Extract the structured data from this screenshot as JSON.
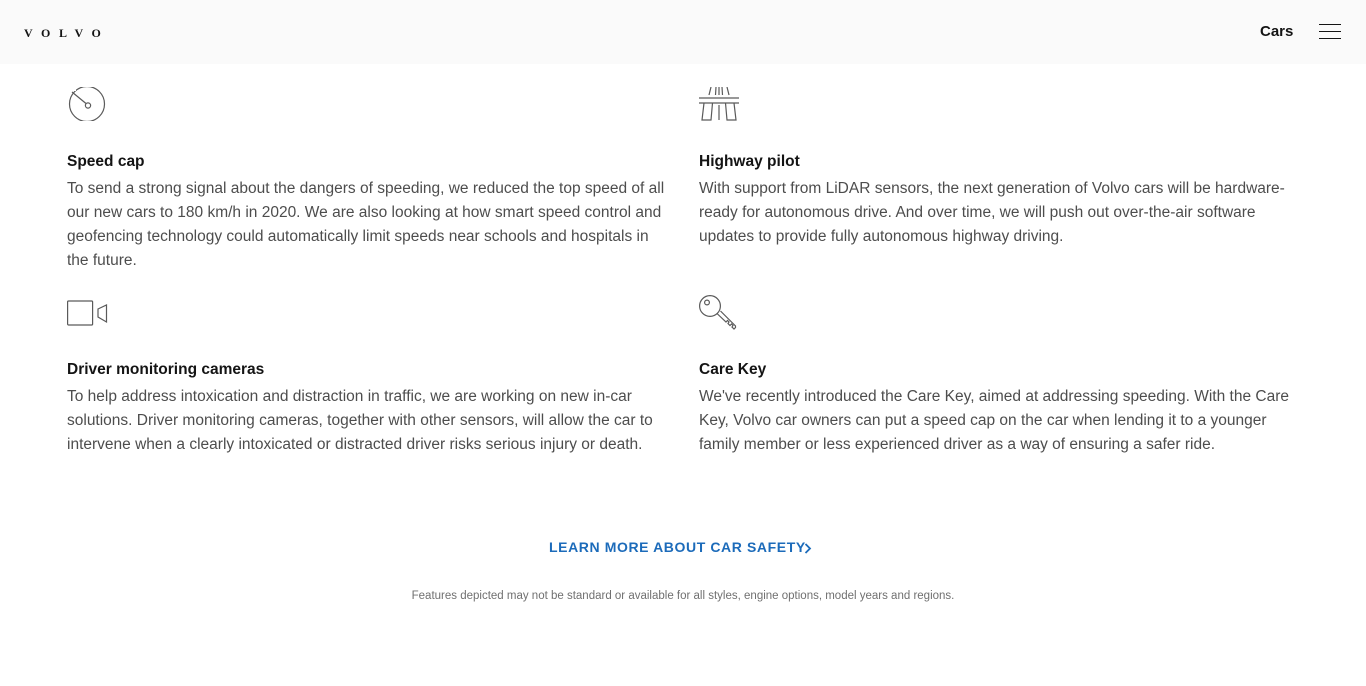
{
  "header": {
    "logo": "VOLVO",
    "nav_cars": "Cars",
    "menu_icon": "hamburger-menu-icon"
  },
  "features": [
    {
      "icon": "speedometer-icon",
      "title": "Speed cap",
      "text": "To send a strong signal about the dangers of speeding, we reduced the top speed of all our new cars to 180 km/h in 2020. We are also looking at how smart speed control and geofencing technology could automatically limit speeds near schools and hospitals in the future."
    },
    {
      "icon": "highway-icon",
      "title": "Highway pilot",
      "text": "With support from LiDAR sensors, the next generation of Volvo cars will be hardware-ready for autonomous drive. And over time, we will push out over-the-air software updates to provide fully autonomous highway driving."
    },
    {
      "icon": "camera-icon",
      "title": "Driver monitoring cameras",
      "text": "To help address intoxication and distraction in traffic, we are working on new in-car solutions. Driver monitoring cameras, together with other sensors, will allow the car to intervene when a clearly intoxicated or distracted driver risks serious injury or death."
    },
    {
      "icon": "key-icon",
      "title": "Care Key",
      "text": "We've recently introduced the Care Key, aimed at addressing speeding. With the Care Key, Volvo car owners can put a speed cap on the car when lending it to a younger family member or less experienced driver as a way of ensuring a safer ride."
    }
  ],
  "cta": {
    "label": "LEARN MORE ABOUT CAR SAFETY",
    "icon": "chevron-right-icon"
  },
  "disclaimer": "Features depicted may not be standard or available for all styles, engine options, model years and regions.",
  "colors": {
    "header_bg": "#fafafa",
    "text_primary": "#141414",
    "text_body": "#4d4d4d",
    "link": "#1c6bba",
    "icon_stroke": "#5a5a5a"
  }
}
